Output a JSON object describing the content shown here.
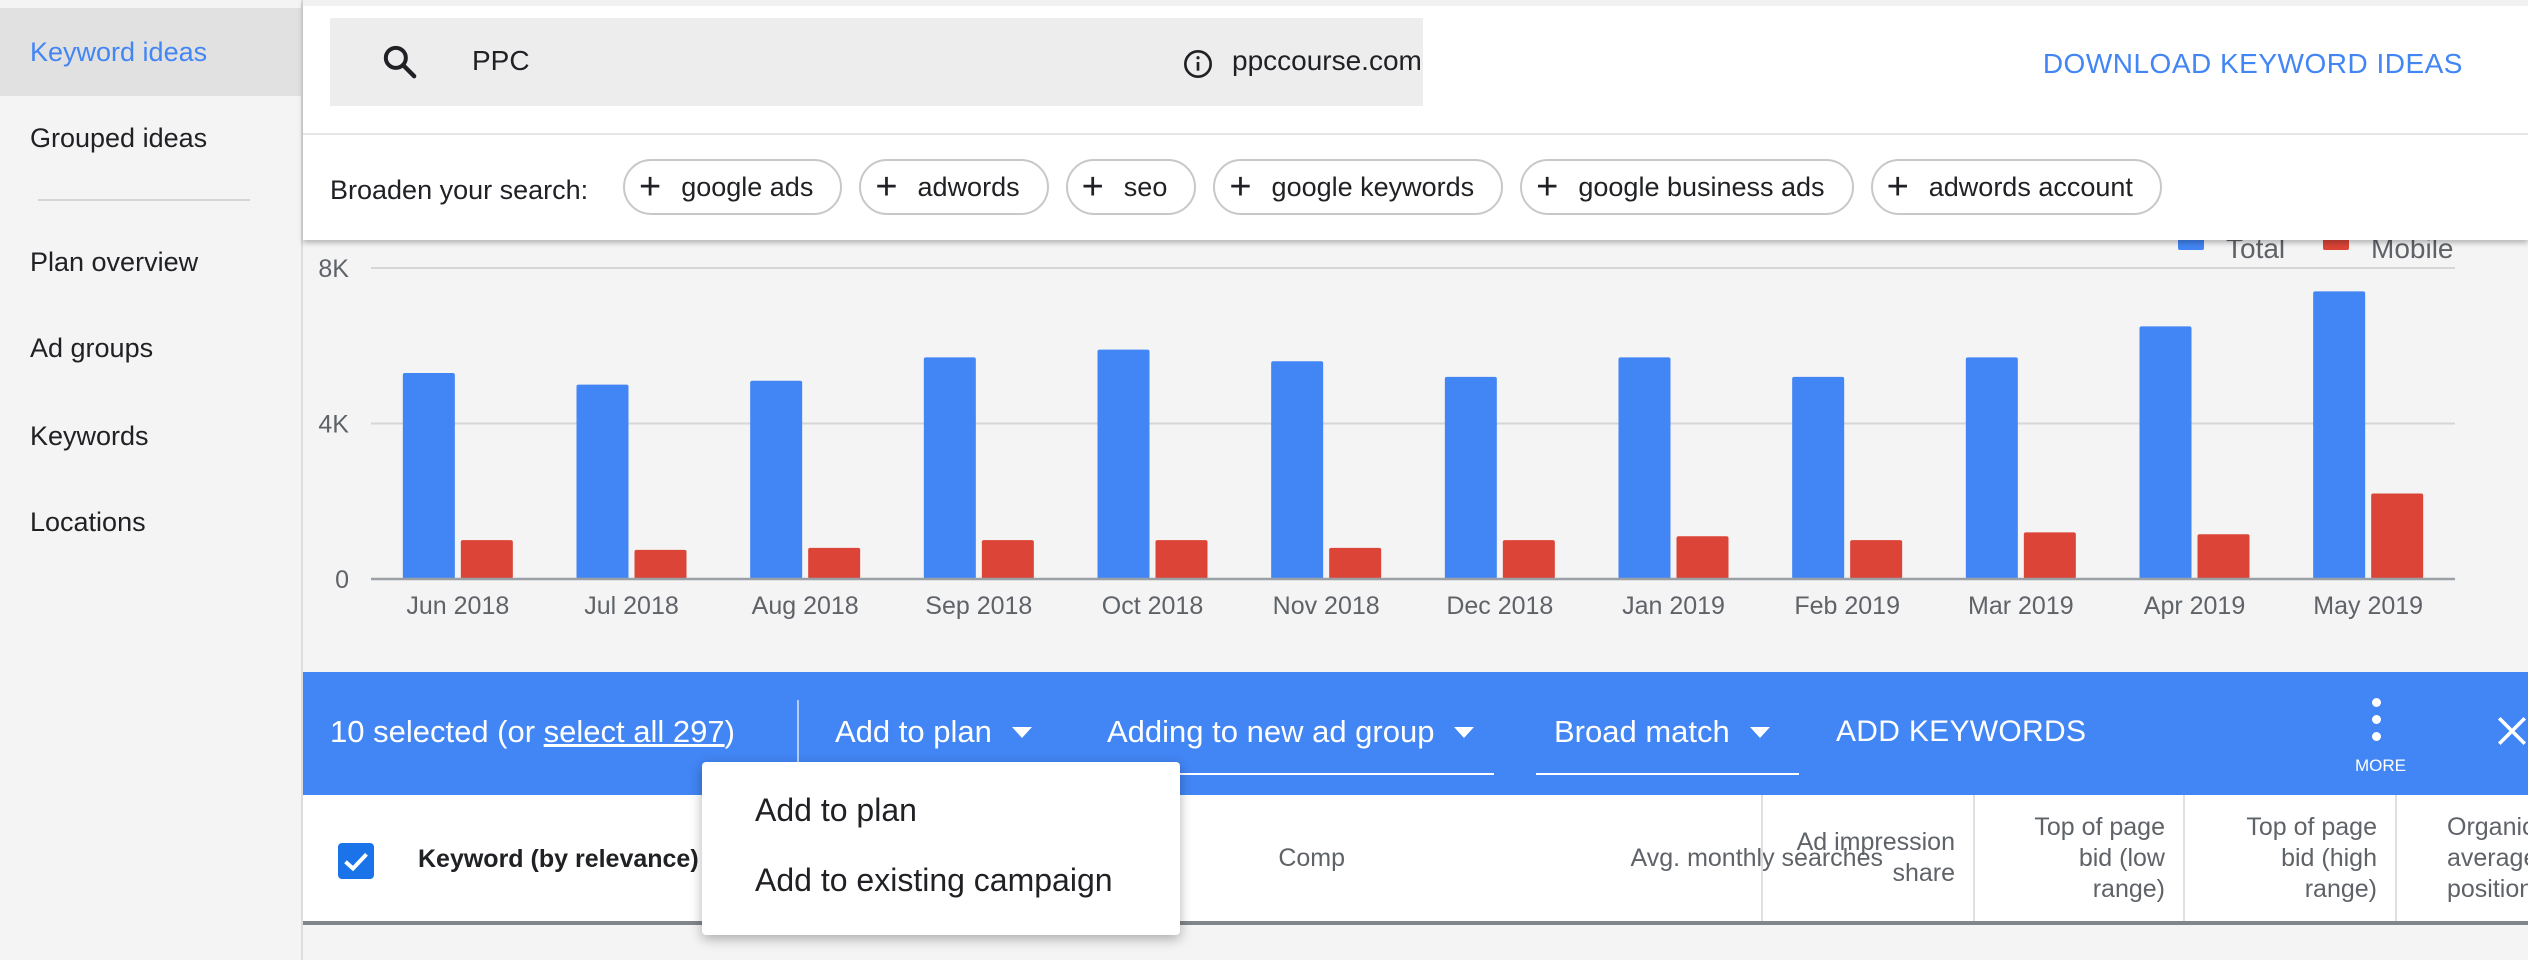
{
  "sidebar": {
    "items": [
      {
        "label": "Keyword ideas",
        "active": true
      },
      {
        "label": "Grouped ideas"
      },
      {
        "label": "Plan overview"
      },
      {
        "label": "Ad groups"
      },
      {
        "label": "Keywords"
      },
      {
        "label": "Locations"
      }
    ]
  },
  "header": {
    "search_value": "PPC",
    "domain": "ppccourse.com",
    "download_label": "DOWNLOAD KEYWORD IDEAS",
    "broaden_label": "Broaden your search:",
    "chips": [
      "google ads",
      "adwords",
      "seo",
      "google keywords",
      "google business ads",
      "adwords account"
    ]
  },
  "colors": {
    "accent": "#4285f4",
    "total": "#4285f4",
    "mobile": "#db4437",
    "checkbox": "#1a73e8"
  },
  "chart_data": {
    "type": "bar",
    "title": "",
    "xlabel": "",
    "ylabel": "",
    "categories": [
      "Jun 2018",
      "Jul 2018",
      "Aug 2018",
      "Sep 2018",
      "Oct 2018",
      "Nov 2018",
      "Dec 2018",
      "Jan 2019",
      "Feb 2019",
      "Mar 2019",
      "Apr 2019",
      "May 2019"
    ],
    "series": [
      {
        "name": "Total",
        "color": "#4285f4",
        "values": [
          5300,
          5000,
          5100,
          5700,
          5900,
          5600,
          5200,
          5700,
          5200,
          5700,
          6500,
          7400
        ]
      },
      {
        "name": "Mobile",
        "color": "#db4437",
        "values": [
          1000,
          750,
          800,
          1000,
          1000,
          800,
          1000,
          1100,
          1000,
          1200,
          1150,
          2200
        ]
      }
    ],
    "ylim": [
      0,
      8000
    ],
    "yticks": [
      0,
      4000,
      8000
    ],
    "ytick_labels": [
      "0",
      "4K",
      "8K"
    ],
    "grid": true,
    "legend_position": "top-right"
  },
  "action_bar": {
    "selected_prefix": "10 selected (or ",
    "select_all_label": "select all 297",
    "selected_suffix": ")",
    "add_to_plan": "Add to plan",
    "ad_group": "Adding to new ad group",
    "match_type": "Broad match",
    "add_keywords": "ADD KEYWORDS",
    "more_label": "MORE"
  },
  "menu": {
    "items": [
      "Add to plan",
      "Add to existing campaign"
    ]
  },
  "table": {
    "columns": [
      "Keyword (by relevance)",
      "Comp",
      "Avg. monthly searches",
      "Ad impression share",
      "Top of page bid (low range)",
      "Top of page bid (high range)",
      "Organic average position"
    ],
    "visible_partial_last": "Org ave pos"
  }
}
